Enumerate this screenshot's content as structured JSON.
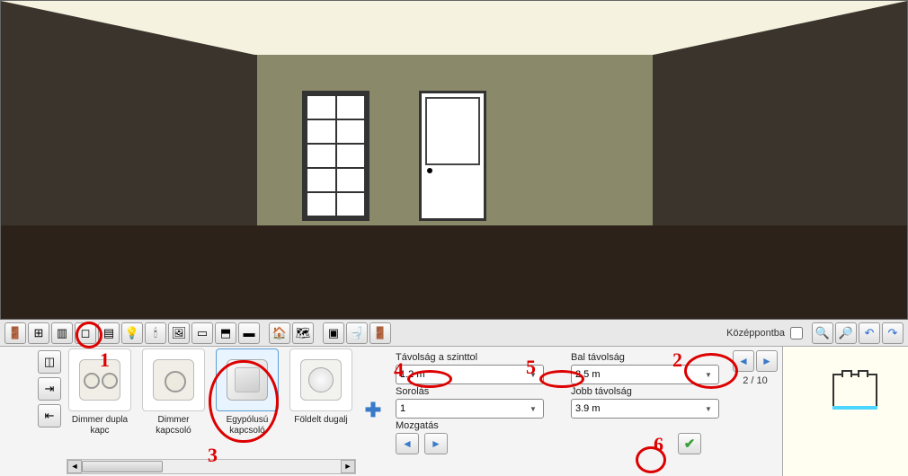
{
  "toolbar": {
    "groups": [
      [
        "door-icon",
        "window-icon",
        "column-icon",
        "switch-icon",
        "radiator-icon",
        "ceiling-lamp-icon",
        "floor-lamp-icon",
        "picture-icon",
        "carpet-icon",
        "roof-icon",
        "slab-icon"
      ],
      [
        "building-icon",
        "map-icon"
      ],
      [
        "stove-icon",
        "toilet-icon",
        "wardrobe-icon"
      ]
    ],
    "center_label": "Középpontba",
    "right": [
      "zoom-in-icon",
      "zoom-out-icon",
      "undo-icon",
      "redo-icon"
    ]
  },
  "catalog": {
    "items": [
      {
        "id": "dimmer-double",
        "label": "Dimmer dupla kapc"
      },
      {
        "id": "dimmer-single",
        "label": "Dimmer kapcsoló"
      },
      {
        "id": "single-pole",
        "label": "Egypólusú kapcsoló"
      },
      {
        "id": "socket",
        "label": "Földelt dugalj"
      }
    ],
    "selected_index": 2
  },
  "props": {
    "dist_level_label": "Távolság a szinttol",
    "dist_level_value": "1.2 m",
    "left_dist_label": "Bal távolság",
    "left_dist_value": "2.5 m",
    "array_label": "Sorolás",
    "array_value": "1",
    "right_dist_label": "Jobb távolság",
    "right_dist_value": "3.9 m",
    "move_label": "Mozgatás"
  },
  "wallnav": {
    "counter": "2 / 10"
  },
  "annotations": [
    "1",
    "2",
    "3",
    "4",
    "5",
    "6"
  ]
}
